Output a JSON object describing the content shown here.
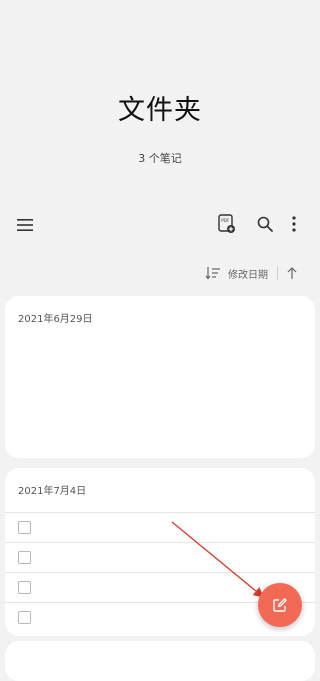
{
  "header": {
    "title": "文件夹",
    "subtitle": "3 个笔记"
  },
  "toolbar": {
    "menu_icon": "hamburger-menu-icon",
    "pdf_icon": "pdf-export-icon",
    "pdf_text": "PDF",
    "search_icon": "search-icon",
    "more_icon": "more-vertical-icon"
  },
  "sort": {
    "label": "修改日期",
    "direction": "ascending"
  },
  "notes": [
    {
      "date": "2021年6月29日"
    },
    {
      "date": "2021年7月4日",
      "checklist_items": 4
    },
    {
      "date": ""
    }
  ],
  "fab": {
    "icon": "compose-note-icon"
  },
  "colors": {
    "background": "#f3f2f2",
    "card": "#ffffff",
    "accent": "#f26a55",
    "annotation_arrow": "#d63a2a"
  }
}
